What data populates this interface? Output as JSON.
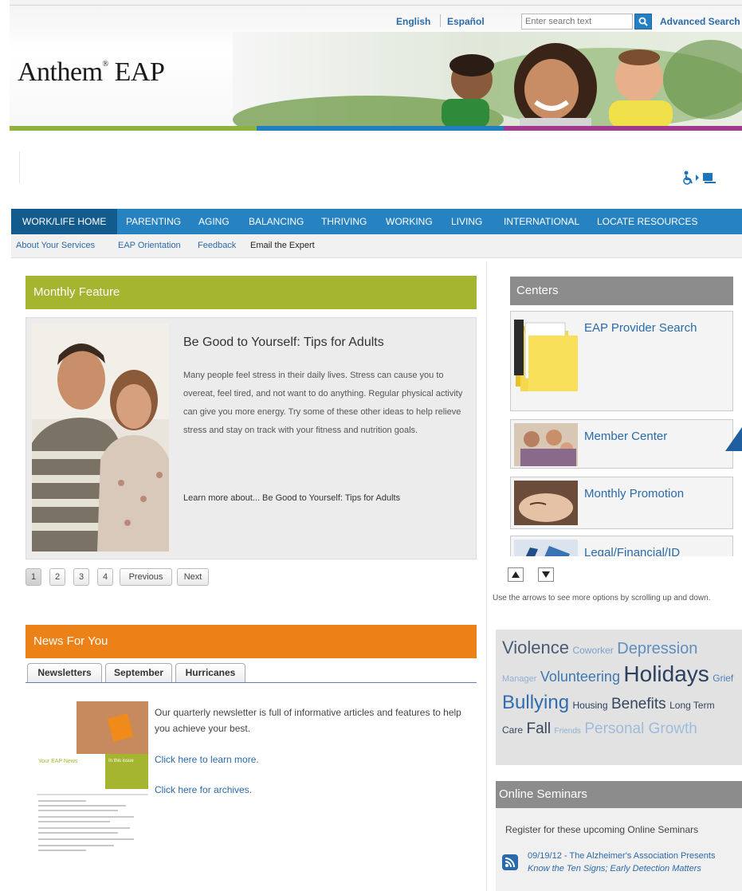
{
  "header": {
    "lang_english": "English",
    "lang_espanol": "Español",
    "search_placeholder": "Enter search text",
    "advanced_search": "Advanced Search",
    "logo_main": "Anthem",
    "logo_reg": "®",
    "logo_sub": "EAP"
  },
  "nav": {
    "items": [
      "WORK/LIFE HOME",
      "PARENTING",
      "AGING",
      "BALANCING",
      "THRIVING",
      "WORKING",
      "LIVING",
      "INTERNATIONAL",
      "LOCATE RESOURCES"
    ],
    "active": "WORK/LIFE HOME"
  },
  "subnav": [
    "About Your Services",
    "EAP Orientation",
    "Feedback",
    "Email the Expert"
  ],
  "monthly_feature": {
    "heading": "Monthly Feature",
    "title": "Be Good to Yourself: Tips for Adults",
    "body": "Many people feel stress in their daily lives. Stress can cause you to overeat, feel tired, and not want to do anything. Regular physical activity can give you more energy. Try some of these other ideas to help relieve stress and stay on track with your fitness and nutrition goals.",
    "link": "Learn more about... Be Good to Yourself: Tips for Adults",
    "pagination": [
      "1",
      "2",
      "3",
      "4",
      "Previous",
      "Next"
    ],
    "current_page": "1"
  },
  "news": {
    "heading": "News For You",
    "tabs": [
      "Newsletters",
      "September",
      "Hurricanes"
    ],
    "active_tab": "Newsletters",
    "text": "Our quarterly newsletter is full of informative articles and features to help you achieve your best.",
    "link_learn": "Click here to learn more.",
    "link_archives": "Click here for archives.",
    "cover_title": "Your EAP News",
    "cover_box": "In this issue"
  },
  "centers": {
    "heading": "Centers",
    "items": [
      "EAP Provider Search",
      "Member Center",
      "Monthly Promotion",
      "Legal/Financial/ID"
    ],
    "hint": "Use the arrows to see more options by scrolling up and down."
  },
  "tag_cloud": [
    "Violence",
    "Coworker",
    "Depression",
    "Manager",
    "Volunteering",
    "Holidays",
    "Grief",
    "Bullying",
    "Housing",
    "Benefits",
    "Long Term",
    "Care",
    "Fall",
    "Friends",
    "Personal Growth"
  ],
  "online_seminars": {
    "heading": "Online Seminars",
    "register": "Register for these upcoming Online Seminars",
    "item_line1": "09/19/12 - The Alzheimer's Association Presents",
    "item_line2": "Know the Ten Signs; Early Detection Matters"
  },
  "colors": {
    "nav_blue": "#2682c1",
    "nav_active": "#135b8d",
    "feature_green": "#a5b52f",
    "news_orange": "#ec8117",
    "panel_gray": "#8c8c8c",
    "link_blue": "#2a6aa8"
  },
  "icons": [
    "search-icon",
    "accessibility-icon",
    "arrow-up-icon",
    "arrow-down-icon",
    "rss-icon"
  ]
}
